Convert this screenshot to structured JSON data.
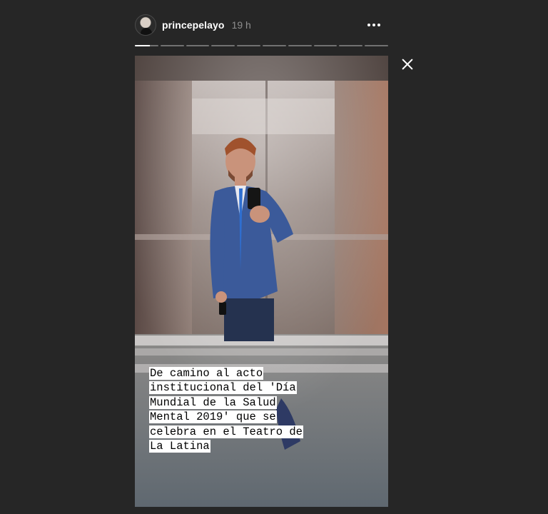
{
  "story": {
    "username": "princepelayo",
    "time": "19 h",
    "segments": 10,
    "current_segment": 1,
    "current_progress": 0.65,
    "caption": "De camino al acto institucional del 'Día Mundial de la Salud Mental 2019' que se celebra en el Teatro de La Latina"
  },
  "icons": {
    "more": "more-horizontal-icon",
    "close": "close-icon",
    "avatar": "user-avatar"
  },
  "colors": {
    "background": "#262626",
    "text": "#ffffff",
    "muted": "#8e8e8e"
  }
}
